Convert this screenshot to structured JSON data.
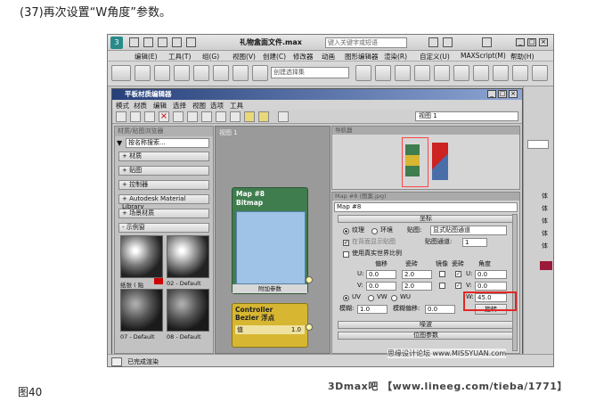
{
  "caption": "(37)再次设置“W角度”参数。",
  "figure_label": "图40",
  "bottom_watermark": "3Dmax吧 【www.lineeg.com/tieba/1771】",
  "max": {
    "title": "礼物盒面文件.max",
    "search_placeholder": "键入关键字或短语",
    "menu": [
      "编辑(E)",
      "工具(T)",
      "组(G)",
      "视图(V)",
      "创建(C)",
      "修改器",
      "动画",
      "图形编辑器",
      "渲染(R)",
      "自定义(U)",
      "MAXScript(M)",
      "帮助(H)"
    ],
    "selection_set": "创建选择集",
    "status": "已完成渲染",
    "right_labels": [
      "体",
      "体",
      "体",
      "体",
      "体"
    ]
  },
  "slate": {
    "title": "平板材质编辑器",
    "menu": [
      "模式",
      "材质",
      "编辑",
      "选择",
      "视图",
      "选项",
      "工具"
    ],
    "view_select": "视图 1",
    "browser_header": "材质/贴图浏览器",
    "browser_search": "按名称搜索...",
    "categories": [
      "+ 材质",
      "+ 贴图",
      "+ 控制器",
      "+ Autodesk Material Library",
      "+ 场景材质",
      "- 示例窗"
    ],
    "thumbs": [
      "纸张 ( 贴",
      "02 - Default",
      "07 - Default",
      "08 - Default"
    ],
    "view_tab": "视图 1",
    "map_node": {
      "title": "Map #8",
      "type": "Bitmap",
      "footer": "附加参数"
    },
    "ctl_node": {
      "title": "Controller",
      "type": "Bezier 浮点",
      "row_label": "值",
      "row_value": "1.0"
    },
    "navigator_header": "导航器",
    "params_header": "Map #8 (图案.jpg)",
    "map_name": "Map #8",
    "coords": {
      "rollout": "坐标",
      "texture": "纹理",
      "environ": "环境",
      "mapping_label": "贴图:",
      "mapping_value": "显式贴图通道",
      "show_bg": "在背面显示贴图",
      "channel_label": "贴图通道:",
      "channel_value": "1",
      "real_world": "使用真实世界比例",
      "col_offset": "偏移",
      "col_tiling": "瓷砖",
      "col_mirror": "镜像",
      "col_tile": "瓷砖",
      "col_angle": "角度",
      "u_label": "U:",
      "v_label": "V:",
      "u_offset": "0.0",
      "u_tiling": "2.0",
      "u_angle": "0.0",
      "v_offset": "0.0",
      "v_tiling": "2.0",
      "v_angle": "0.0",
      "w_label": "W:",
      "w_angle": "45.0",
      "uv": "UV",
      "vw": "VW",
      "wu": "WU",
      "blur_label": "模糊:",
      "blur_value": "1.0",
      "blur_offset_label": "模糊偏移:",
      "blur_offset_value": "0.0",
      "rotate_button": "旋转"
    },
    "noise_rollout": "噪波",
    "bitmap_rollout": "位图参数"
  },
  "site_watermark": "思缘设计论坛 www.MISSYUAN.com",
  "colors": {
    "map_node": "#3f7d4e",
    "ctl_node": "#d7b632",
    "highlight": "#e32626",
    "title_bar": "#26407a"
  }
}
